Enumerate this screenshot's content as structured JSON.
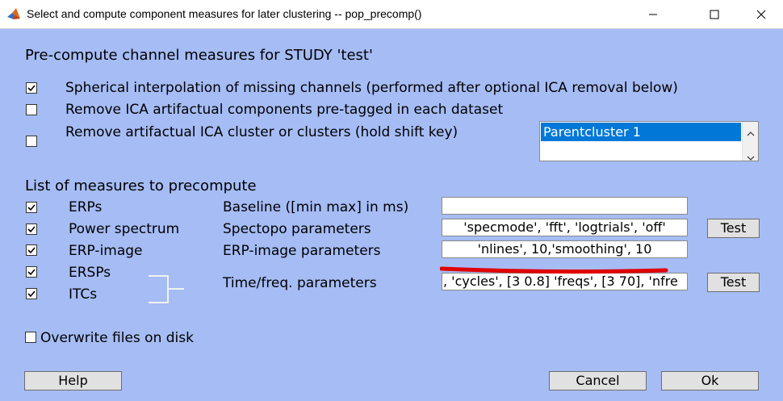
{
  "window": {
    "title": "Select and compute component measures for later clustering -- pop_precomp()",
    "icons": {
      "app": "matlab-icon",
      "minimize": "minimize-icon",
      "maximize": "maximize-icon",
      "close": "close-icon"
    }
  },
  "precompute": {
    "heading": "Pre-compute channel measures for STUDY 'test'",
    "options": [
      {
        "label": "Spherical interpolation of missing channels (performed after optional ICA removal below)",
        "checked": true
      },
      {
        "label": "Remove ICA artifactual components pre-tagged in each dataset",
        "checked": false
      },
      {
        "label": "Remove artifactual ICA cluster or clusters (hold shift key)",
        "checked": false
      }
    ],
    "cluster_list": {
      "items": [
        "Parentcluster 1"
      ],
      "selected": "Parentcluster 1"
    }
  },
  "measures": {
    "heading": "List of measures to precompute",
    "items": [
      {
        "label": "ERPs",
        "checked": true
      },
      {
        "label": "Power spectrum",
        "checked": true
      },
      {
        "label": "ERP-image",
        "checked": true
      },
      {
        "label": "ERSPs",
        "checked": true
      },
      {
        "label": "ITCs",
        "checked": true
      }
    ],
    "params": {
      "baseline_label": "Baseline ([min max] in ms)",
      "baseline_value": "",
      "spectopo_label": "Spectopo parameters",
      "spectopo_value": "'specmode', 'fft', 'logtrials', 'off'",
      "erpimage_label": "ERP-image parameters",
      "erpimage_value": "'nlines', 10,'smoothing', 10",
      "timef_label": "Time/freq. parameters",
      "timef_value": ", 'cycles', [3 0.8] 'freqs', [3 70],  'nfre",
      "test_label": "Test"
    }
  },
  "overwrite": {
    "label": "Overwrite files on disk",
    "checked": false
  },
  "buttons": {
    "help": "Help",
    "cancel": "Cancel",
    "ok": "Ok"
  },
  "colors": {
    "background": "#a6bcf5",
    "selection": "#0078d7",
    "annotation": "#e00000"
  }
}
